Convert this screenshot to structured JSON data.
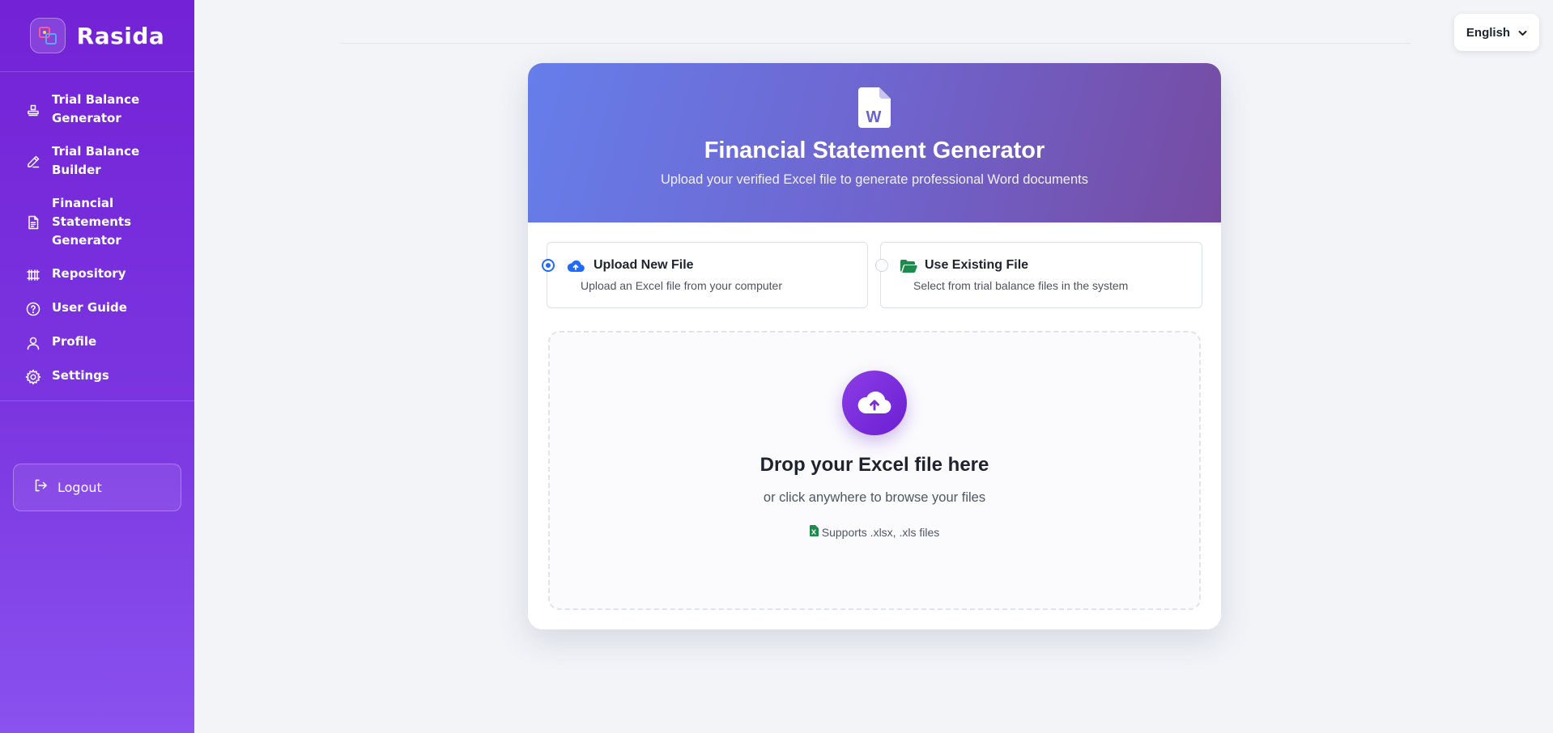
{
  "app": {
    "name": "Rasida"
  },
  "sidebar": {
    "items": [
      {
        "label": "Trial Balance Generator",
        "icon": "stamp-icon"
      },
      {
        "label": "Trial Balance Builder",
        "icon": "pencil-icon"
      },
      {
        "label": "Financial Statements Generator",
        "icon": "document-icon"
      },
      {
        "label": "Repository",
        "icon": "archive-icon"
      },
      {
        "label": "User Guide",
        "icon": "question-circle-icon"
      },
      {
        "label": "Profile",
        "icon": "user-icon"
      },
      {
        "label": "Settings",
        "icon": "gear-icon"
      }
    ],
    "logout_label": "Logout"
  },
  "language": {
    "selected": "English"
  },
  "card": {
    "title": "Financial Statement Generator",
    "subtitle": "Upload your verified Excel file to generate professional Word documents",
    "options": [
      {
        "title": "Upload New File",
        "description": "Upload an Excel file from your computer",
        "selected": true
      },
      {
        "title": "Use Existing File",
        "description": "Select from trial balance files in the system",
        "selected": false
      }
    ],
    "dropzone": {
      "title": "Drop your Excel file here",
      "subtitle": "or click anywhere to browse your files",
      "support": "Supports .xlsx, .xls files"
    }
  },
  "colors": {
    "sidebar_top": "#7322d6",
    "sidebar_bottom": "#8a52ef",
    "header_start": "#667eea",
    "header_end": "#764ba2",
    "radio_selected": "#1f6bff",
    "upload_icon": "#1f6bff",
    "folder_icon": "#1e8a4c",
    "excel_green": "#1e8a4c"
  }
}
